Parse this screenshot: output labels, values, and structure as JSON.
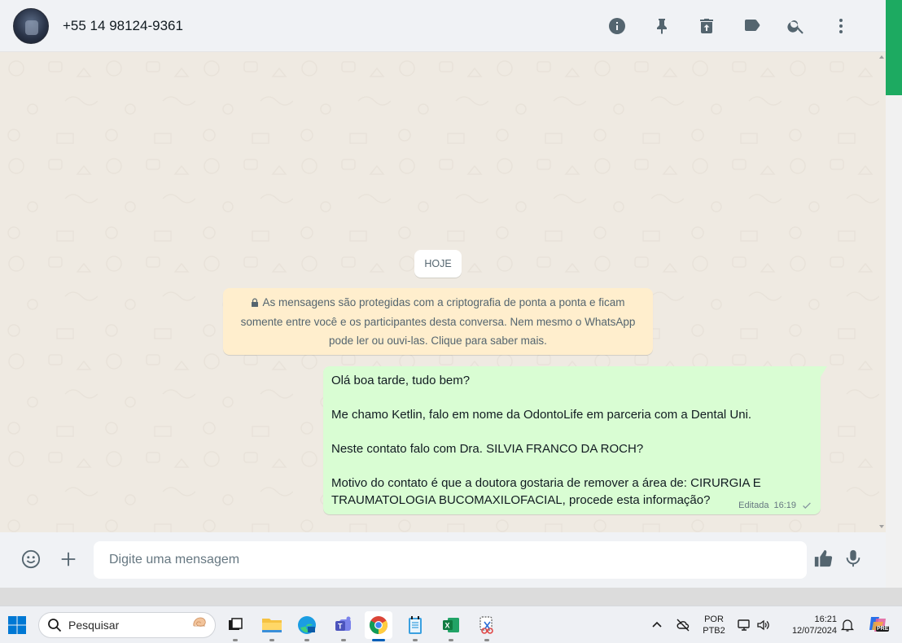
{
  "header": {
    "contact_name": "+55 14 98124-9361",
    "icons": [
      "info-icon",
      "pin-icon",
      "delete-icon",
      "label-icon",
      "search-icon",
      "menu-icon"
    ]
  },
  "chat": {
    "date_label": "HOJE",
    "encryption_notice": {
      "line1": "As mensagens são protegidas com a criptografia de ponta a ponta e ficam",
      "line2": "somente entre você e os participantes desta conversa. Nem mesmo o WhatsApp",
      "line3": "pode ler ou ouvi-las. Clique para saber mais."
    },
    "message": {
      "paragraphs": [
        "Olá boa tarde, tudo bem?",
        "Me chamo Ketlin, falo em nome da OdontoLife em parceria com a Dental Uni.",
        "Neste contato falo com Dra. SILVIA FRANCO DA ROCH?",
        "Motivo do contato é que a doutora gostaria de remover a área de: CIRURGIA E",
        "TRAUMATOLOGIA BUCOMAXILOFACIAL, procede esta informação?"
      ],
      "status": "Editada",
      "time": "16:19"
    }
  },
  "composer": {
    "placeholder": "Digite uma mensagem"
  },
  "taskbar": {
    "search_placeholder": "Pesquisar",
    "language_line1": "POR",
    "language_line2": "PTB2",
    "clock_time": "16:21",
    "clock_date": "12/07/2024",
    "copilot_badge": "PRE"
  },
  "colors": {
    "accent": "#1daa61",
    "bubble_out": "#d9fdd3",
    "chat_bg": "#efeae2",
    "notice_bg": "#ffeecd"
  }
}
